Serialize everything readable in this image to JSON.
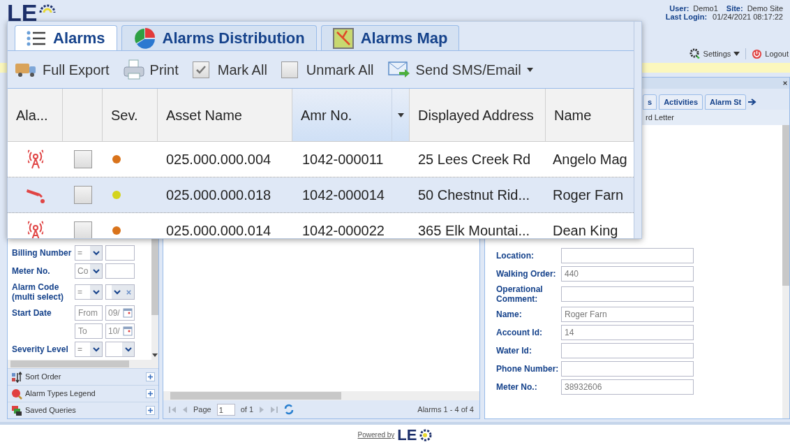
{
  "header": {
    "logo": "LE",
    "user_label": "User:",
    "user": "Demo1",
    "site_label": "Site:",
    "site": "Demo Site",
    "last_login_label": "Last Login:",
    "last_login": "01/24/2021 08:17:22",
    "settings": "Settings",
    "logout": "Logout"
  },
  "filters": [
    {
      "kind": "select",
      "label": "Billing Number",
      "operator": "="
    },
    {
      "kind": "select",
      "label": "Meter No.",
      "operator": "Co"
    },
    {
      "kind": "multi",
      "label": "Alarm Code (multi select)",
      "operator": "="
    },
    {
      "kind": "date",
      "label": "Start Date",
      "from": "From",
      "from_value": "09/",
      "to": "To",
      "to_value": "10/"
    },
    {
      "kind": "select2",
      "label": "Severity Level",
      "operator": "="
    }
  ],
  "accordion": [
    {
      "kind": "sort",
      "label": "Sort Order"
    },
    {
      "kind": "legend",
      "label": "Alarm Types Legend"
    },
    {
      "kind": "queries",
      "label": "Saved Queries"
    }
  ],
  "pager": {
    "page_label": "Page",
    "page": "1",
    "of": "of 1",
    "summary": "Alarms 1 - 4 of 4"
  },
  "details": {
    "tabs": [
      {
        "label": "s"
      },
      {
        "label": "Activities"
      },
      {
        "label": "Alarm St"
      }
    ],
    "toolbar_text": "rd Letter",
    "fields": [
      {
        "label": "Location:"
      },
      {
        "label": "Walking Order:",
        "value": "440"
      },
      {
        "label": "Operational Comment:"
      },
      {
        "label": "Name:",
        "value": "Roger Farn"
      },
      {
        "label": "Account Id:",
        "value": "14"
      },
      {
        "label": "Water Id:"
      },
      {
        "label": "Phone Number:"
      },
      {
        "label": "Meter No.:",
        "value": "38932606"
      }
    ]
  },
  "footer": {
    "powered_by": "Powered by",
    "logo": "LE"
  },
  "popup": {
    "tabs": [
      {
        "label": "Alarms",
        "selected": true
      },
      {
        "label": "Alarms Distribution",
        "selected": false
      },
      {
        "label": "Alarms Map",
        "selected": false
      }
    ],
    "toolbar": [
      {
        "kind": "export",
        "label": "Full Export"
      },
      {
        "kind": "print",
        "label": "Print"
      },
      {
        "kind": "check",
        "label": "Mark All",
        "checked": true
      },
      {
        "kind": "check",
        "label": "Unmark All",
        "checked": false
      },
      {
        "kind": "send",
        "label": "Send SMS/Email"
      }
    ],
    "columns": [
      {
        "label": "Ala...",
        "sorted": false
      },
      {
        "sorted": false
      },
      {
        "label": "Sev.",
        "sorted": false
      },
      {
        "label": "Asset Name",
        "sorted": false
      },
      {
        "label": "Amr No.",
        "sorted": true
      },
      {
        "label": "Displayed Address",
        "sorted": false
      },
      {
        "label": "Name",
        "sorted": false
      }
    ],
    "rows": [
      {
        "kind": "antenna",
        "checked": false,
        "color": "#d9731b",
        "asset": "025.000.000.004",
        "amr": "1042-000011",
        "address": "25 Lees Creek Rd",
        "name": "Angelo Mag",
        "selected": false
      },
      {
        "kind": "pipe",
        "checked": false,
        "color": "#d4d41c",
        "asset": "025.000.000.018",
        "amr": "1042-000014",
        "address": "50 Chestnut Rid...",
        "name": "Roger Farn",
        "selected": true
      },
      {
        "kind": "antenna",
        "checked": false,
        "color": "#d9731b",
        "asset": "025.000.000.014",
        "amr": "1042-000022",
        "address": "365 Elk Mountai...",
        "name": "Dean King",
        "selected": false
      }
    ]
  }
}
